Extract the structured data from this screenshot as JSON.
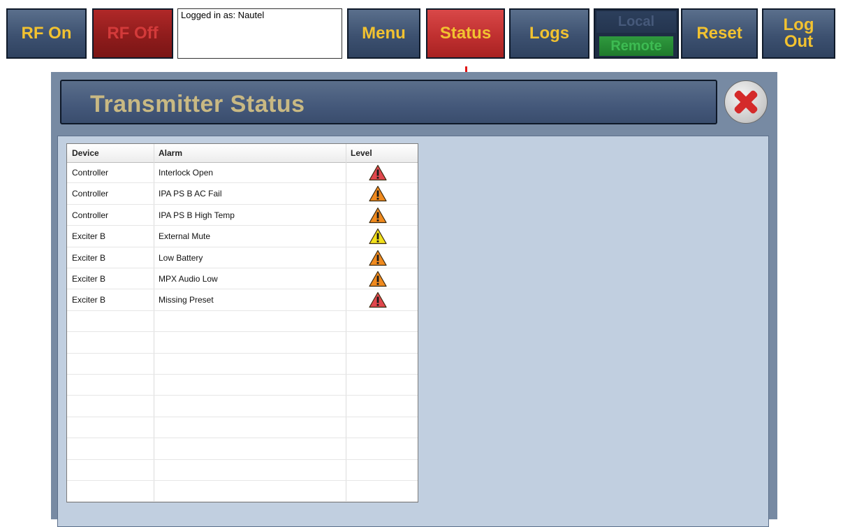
{
  "toolbar": {
    "rf_on": "RF On",
    "rf_off": "RF Off",
    "login_text": "Logged in as: Nautel",
    "menu": "Menu",
    "status": "Status",
    "logs": "Logs",
    "local": "Local",
    "remote": "Remote",
    "reset": "Reset",
    "logout_line1": "Log",
    "logout_line2": "Out"
  },
  "dialog": {
    "title": "Transmitter Status",
    "close_icon": "close-x-icon"
  },
  "table": {
    "headers": [
      "Device",
      "Alarm",
      "Level"
    ],
    "rows": [
      {
        "device": "Controller",
        "alarm": "Interlock Open",
        "level": "red"
      },
      {
        "device": "Controller",
        "alarm": "IPA PS B AC Fail",
        "level": "orange"
      },
      {
        "device": "Controller",
        "alarm": "IPA PS B High Temp",
        "level": "orange"
      },
      {
        "device": "Exciter B",
        "alarm": "External Mute",
        "level": "yellow"
      },
      {
        "device": "Exciter B",
        "alarm": "Low Battery",
        "level": "orange"
      },
      {
        "device": "Exciter B",
        "alarm": "MPX Audio Low",
        "level": "orange"
      },
      {
        "device": "Exciter B",
        "alarm": "Missing Preset",
        "level": "red"
      }
    ],
    "level_colors": {
      "red": "#e0474d",
      "orange": "#f08a1e",
      "yellow": "#f2e01c"
    }
  },
  "colors": {
    "button_text": "#f2c230",
    "accent_red": "#c83232",
    "panel_bg": "#c1cfe0",
    "arrow": "#e01515"
  }
}
